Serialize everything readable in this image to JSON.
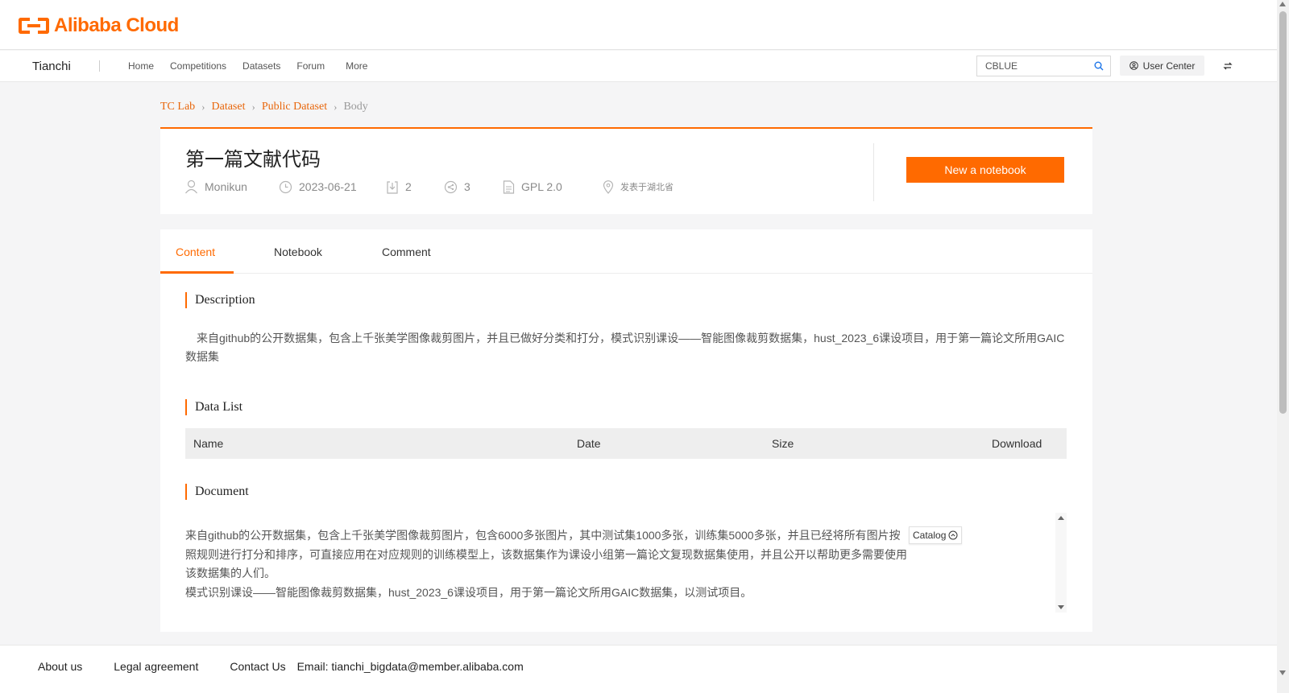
{
  "header": {
    "logo_text": "Alibaba Cloud",
    "brand": "Tianchi",
    "nav": [
      "Home",
      "Competitions",
      "Datasets",
      "Forum",
      "More"
    ],
    "search_value": "CBLUE",
    "user_center": "User Center"
  },
  "breadcrumb": [
    "TC Lab",
    "Dataset",
    "Public Dataset",
    "Body"
  ],
  "dataset": {
    "title": "第一篇文献代码",
    "author": "Monikun",
    "date": "2023-06-21",
    "forks": "2",
    "views": "3",
    "license": "GPL 2.0",
    "location": "发表于湖北省",
    "new_notebook": "New a notebook"
  },
  "tabs": [
    "Content",
    "Notebook",
    "Comment"
  ],
  "sections": {
    "description_title": "Description",
    "description_text": "来自github的公开数据集，包含上千张美学图像裁剪图片，并且已做好分类和打分，模式识别课设——智能图像裁剪数据集，hust_2023_6课设项目，用于第一篇论文所用GAIC数据集",
    "data_list_title": "Data List",
    "table_headers": [
      "Name",
      "Date",
      "Size",
      "Download"
    ],
    "document_title": "Document",
    "document_paragraphs": [
      "来自github的公开数据集，包含上千张美学图像裁剪图片，包含6000多张图片，其中测试集1000多张，训练集5000多张，并且已经将所有图片按照规则进行打分和排序，可直接应用在对应规则的训练模型上，该数据集作为课设小组第一篇论文复现数据集使用，并且公开以帮助更多需要使用该数据集的人们。",
      "模式识别课设——智能图像裁剪数据集，hust_2023_6课设项目，用于第一篇论文所用GAIC数据集，以测试项目。"
    ],
    "catalog": "Catalog"
  },
  "footer": {
    "about": "About us",
    "legal": "Legal agreement",
    "contact": "Contact Us",
    "email": "Email: tianchi_bigdata@member.alibaba.com"
  },
  "colors": {
    "accent": "#ff6a00",
    "breadcrumb_link": "#e8660b"
  }
}
